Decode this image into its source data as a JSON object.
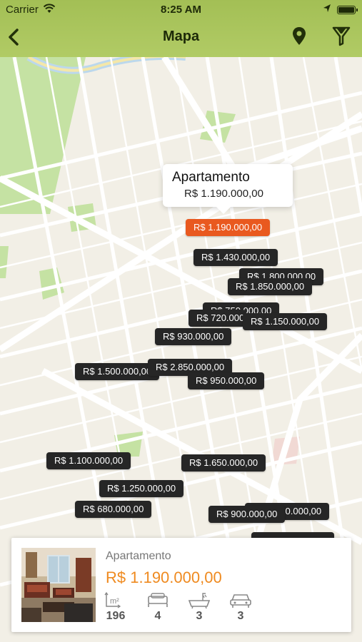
{
  "status": {
    "carrier": "Carrier",
    "time": "8:25 AM"
  },
  "nav": {
    "title": "Mapa"
  },
  "callout": {
    "type": "Apartamento",
    "price": "R$ 1.190.000,00"
  },
  "markers": [
    {
      "label": "R$ 1.190.000,00",
      "active": true
    },
    {
      "label": "R$ 1.430.000,00"
    },
    {
      "label": "R$ 1.800.000,00"
    },
    {
      "label": "R$ 1.850.000,00"
    },
    {
      "label": "R$ 750.000,00"
    },
    {
      "label": "R$ 720.000,00"
    },
    {
      "label": "R$ 1.150.000,00"
    },
    {
      "label": "R$ 930.000,00"
    },
    {
      "label": "R$ 1.500.000,00"
    },
    {
      "label": "R$ 2.850.000,00"
    },
    {
      "label": "R$ 950.000,00"
    },
    {
      "label": "R$ 1.100.000,00"
    },
    {
      "label": "R$ 1.650.000,00"
    },
    {
      "label": "R$ 1.250.000,00"
    },
    {
      "label": "R$ 680.000,00"
    },
    {
      "label": "R$ 1.000.000,00"
    },
    {
      "label": "R$ 900.000,00"
    },
    {
      "label": ""
    }
  ],
  "card": {
    "type": "Apartamento",
    "price": "R$ 1.190.000,00",
    "area": "196",
    "bedrooms": "4",
    "bathrooms": "3",
    "parking": "3"
  },
  "colors": {
    "nav_bg": "#a9c45b",
    "marker_bg": "#262626",
    "marker_active": "#e9591f",
    "price_accent": "#ef8a1f"
  }
}
